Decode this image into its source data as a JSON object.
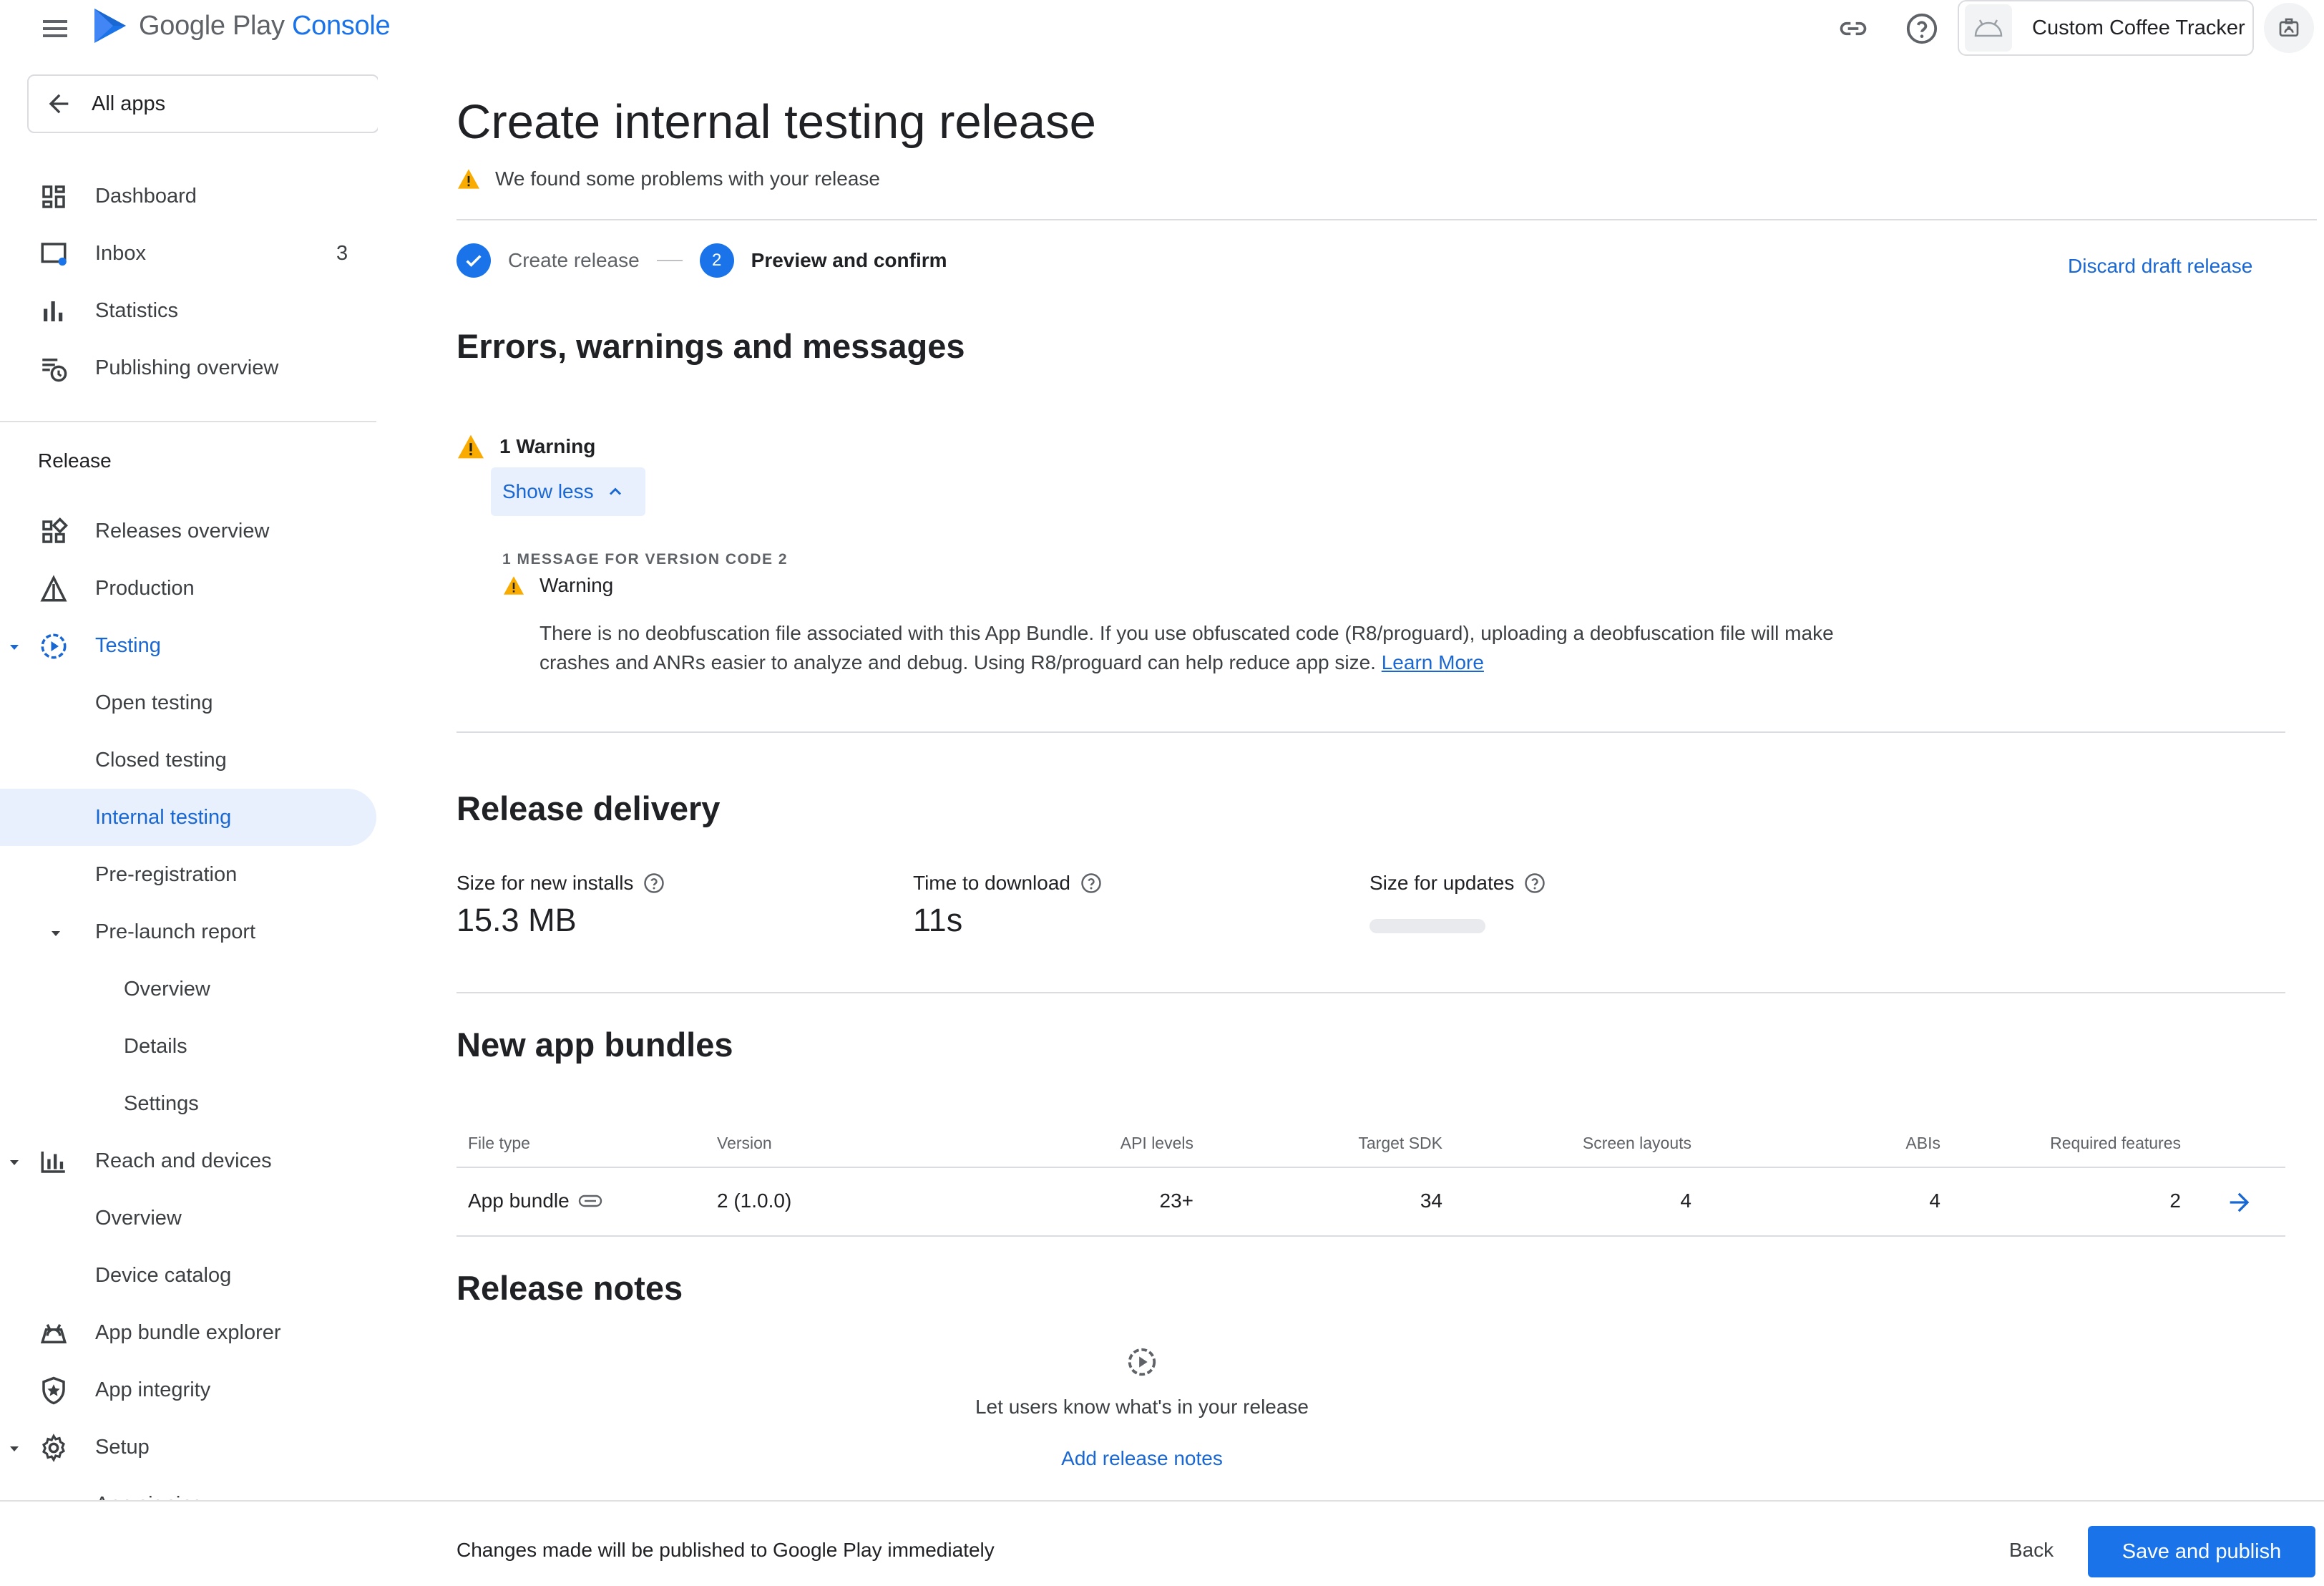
{
  "header": {
    "logo_google": "Google Play",
    "logo_console": "Console",
    "app_name": "Custom Coffee Tracker"
  },
  "sidebar": {
    "all_apps": "All apps",
    "top_items": [
      {
        "label": "Dashboard",
        "icon": "dashboard-icon"
      },
      {
        "label": "Inbox",
        "icon": "inbox-icon",
        "count": "3"
      },
      {
        "label": "Statistics",
        "icon": "bar-chart-icon"
      },
      {
        "label": "Publishing overview",
        "icon": "publishing-icon"
      }
    ],
    "release_section": "Release",
    "release_items": [
      {
        "label": "Releases overview"
      },
      {
        "label": "Production"
      },
      {
        "label": "Testing"
      },
      {
        "label": "Open testing"
      },
      {
        "label": "Closed testing"
      },
      {
        "label": "Internal testing"
      },
      {
        "label": "Pre-registration"
      },
      {
        "label": "Pre-launch report"
      },
      {
        "label": "Overview"
      },
      {
        "label": "Details"
      },
      {
        "label": "Settings"
      },
      {
        "label": "Reach and devices"
      },
      {
        "label": "Overview"
      },
      {
        "label": "Device catalog"
      },
      {
        "label": "App bundle explorer"
      },
      {
        "label": "App integrity"
      },
      {
        "label": "Setup"
      },
      {
        "label": "App signing"
      }
    ]
  },
  "main": {
    "title": "Create internal testing release",
    "problem_text": "We found some problems with your release",
    "stepper": {
      "step1_label": "Create release",
      "step2_number": "2",
      "step2_label": "Preview and confirm"
    },
    "discard_label": "Discard draft release",
    "errors": {
      "heading": "Errors, warnings and messages",
      "warning_count": "1 Warning",
      "show_less": "Show less",
      "caption": "1 MESSAGE FOR VERSION CODE 2",
      "warning_title": "Warning",
      "message": "There is no deobfuscation file associated with this App Bundle. If you use obfuscated code (R8/proguard), uploading a deobfuscation file will make crashes and ANRs easier to analyze and debug. Using R8/proguard can help reduce app size. ",
      "learn_more": "Learn More"
    },
    "delivery": {
      "heading": "Release delivery",
      "new_installs_label": "Size for new installs",
      "new_installs_value": "15.3 MB",
      "download_label": "Time to download",
      "download_value": "11s",
      "updates_label": "Size for updates"
    },
    "bundles": {
      "heading": "New app bundles",
      "columns": [
        "File type",
        "Version",
        "API levels",
        "Target SDK",
        "Screen layouts",
        "ABIs",
        "Required features"
      ],
      "row": {
        "file_type": "App bundle",
        "version": "2 (1.0.0)",
        "api_levels": "23+",
        "target_sdk": "34",
        "screen_layouts": "4",
        "abis": "4",
        "required_features": "2"
      }
    },
    "notes": {
      "heading": "Release notes",
      "empty_text": "Let users know what's in your release",
      "add_label": "Add release notes"
    }
  },
  "footer": {
    "message": "Changes made will be published to Google Play immediately",
    "back_label": "Back",
    "publish_label": "Save and publish"
  },
  "colors": {
    "accent": "#1a73e8",
    "active_bg": "#e8f0fe",
    "warning": "#f9ab00"
  }
}
